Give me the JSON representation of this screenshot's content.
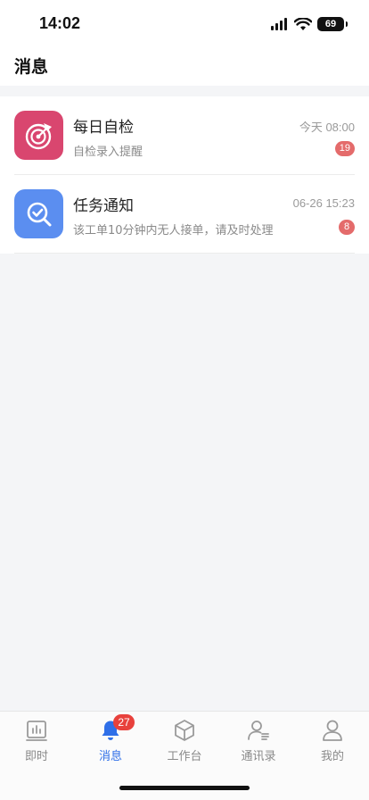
{
  "status_bar": {
    "time": "14:02",
    "battery": "69"
  },
  "header": {
    "title": "消息"
  },
  "messages": [
    {
      "title": "每日自检",
      "time": "今天 08:00",
      "preview": "自检录入提醒",
      "unread": "19",
      "icon": "target-icon",
      "icon_color": "#d9466f"
    },
    {
      "title": "任务通知",
      "time": "06-26 15:23",
      "preview": "该工单10分钟内无人接单，请及时处理",
      "unread": "8",
      "icon": "search-check-icon",
      "icon_color": "#5b8ef0"
    }
  ],
  "tabs": [
    {
      "label": "即时",
      "icon": "chart-icon",
      "active": false
    },
    {
      "label": "消息",
      "icon": "bell-icon",
      "active": true,
      "badge": "27"
    },
    {
      "label": "工作台",
      "icon": "cube-icon",
      "active": false
    },
    {
      "label": "通讯录",
      "icon": "contacts-icon",
      "active": false
    },
    {
      "label": "我的",
      "icon": "user-icon",
      "active": false
    }
  ],
  "colors": {
    "accent": "#2f6fe8",
    "badge": "#e8413c",
    "unread": "#e46b6b"
  }
}
